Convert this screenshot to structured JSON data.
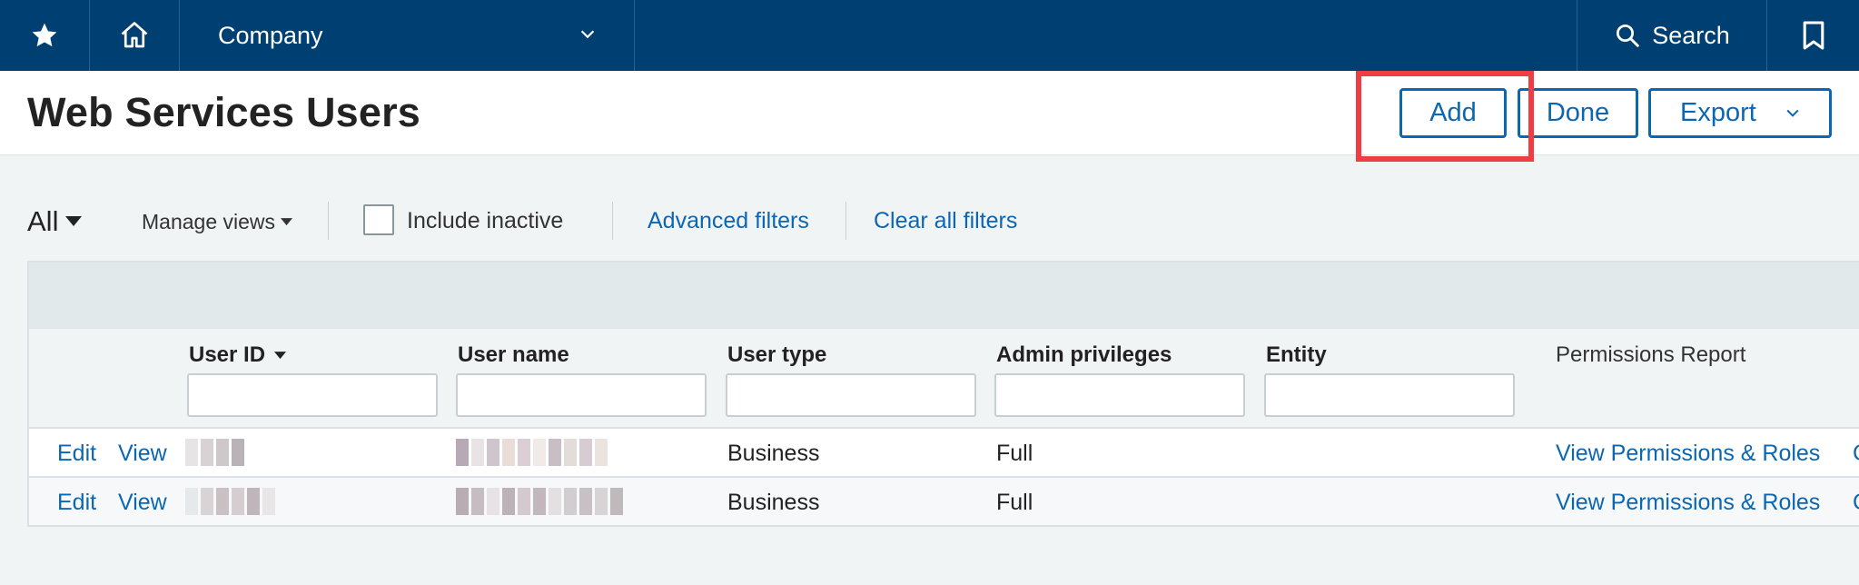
{
  "nav": {
    "company": "Company",
    "search": "Search",
    "icons": [
      "star-icon",
      "home-icon",
      "chevron-down-icon",
      "search-icon",
      "bookmark-icon"
    ]
  },
  "header": {
    "title": "Web Services Users",
    "add_label": "Add",
    "done_label": "Done",
    "export_label": "Export"
  },
  "filters": {
    "view": "All",
    "manage_views": "Manage views",
    "include_inactive": "Include inactive",
    "advanced_filters": "Advanced filters",
    "clear_all": "Clear all filters"
  },
  "table": {
    "columns": [
      "User ID",
      "User name",
      "User type",
      "Admin privileges",
      "Entity",
      "Permissions Report"
    ],
    "rows": [
      {
        "edit": "Edit",
        "view": "View",
        "user_type": "Business",
        "admin": "Full",
        "permissions": "View Permissions & Roles",
        "cut": "C"
      },
      {
        "edit": "Edit",
        "view": "View",
        "user_type": "Business",
        "admin": "Full",
        "permissions": "View Permissions & Roles",
        "cut": "C"
      }
    ]
  },
  "colors": {
    "nav_bg": "#003f72",
    "link": "#0b67b3",
    "highlight": "#ee3e43"
  }
}
